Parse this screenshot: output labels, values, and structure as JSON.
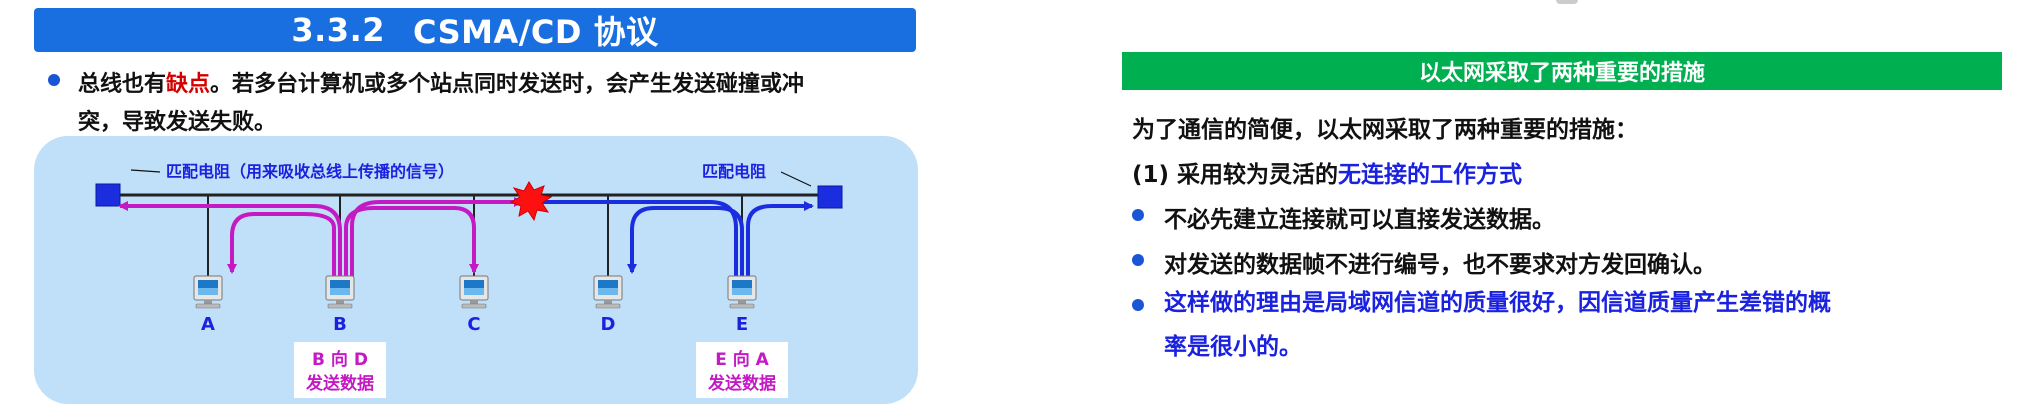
{
  "left": {
    "title_num": "3.3.2",
    "title_text": "CSMA/CD 协议",
    "bullet_pre": "总线也有",
    "bullet_red": "缺点",
    "bullet_post_line1": "。若多台计算机或多个站点同时发送时，会产生发送碰撞或冲",
    "bullet_line2": "突，导致发送失败。",
    "terminator_left_label": "匹配电阻（用来吸收总线上传播的信号）",
    "terminator_right_label": "匹配电阻",
    "stations": [
      "A",
      "B",
      "C",
      "D",
      "E"
    ],
    "box_b_line1": "B 向 D",
    "box_b_line2": "发送数据",
    "box_e_line1": "E 向 A",
    "box_e_line2": "发送数据"
  },
  "right": {
    "header": "以太网采取了两种重要的措施",
    "intro": "为了通信的简便，以太网采取了两种重要的措施：",
    "measure_pre": "(1) 采用较为灵活的",
    "measure_blue": "无连接的工作方式",
    "bullet1": "不必先建立连接就可以直接发送数据。",
    "bullet2": "对发送的数据帧不进行编号，也不要求对方发回确认。",
    "bullet3_line1": "这样做的理由是局域网信道的质量很好，因信道质量产生差错的概",
    "bullet3_line2": "率是很小的。"
  },
  "colors": {
    "title_blue": "#1a6fe0",
    "green_header": "#00b050",
    "magenta": "#c41ac4",
    "blue_arrow": "#1a2ee0",
    "red_text": "#d40000",
    "panel_bg": "#bfe0f8"
  }
}
